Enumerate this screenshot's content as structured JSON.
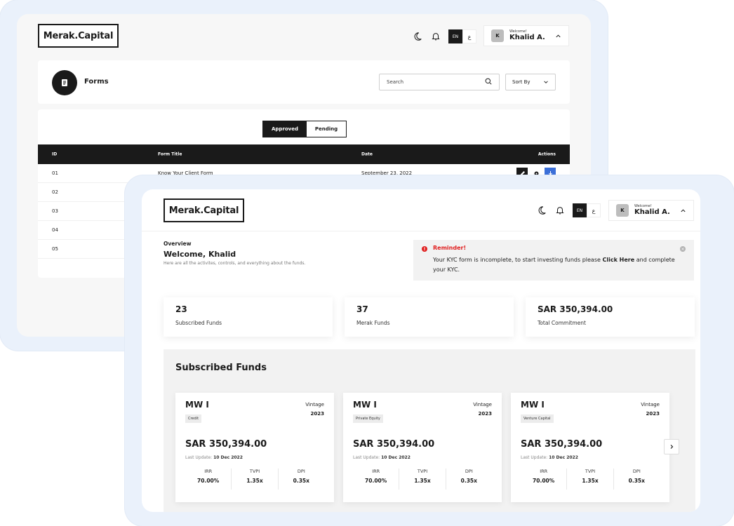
{
  "brand": "Merak.Capital",
  "topbar": {
    "lang_en": "EN",
    "lang_ar": "ع",
    "welcome": "Welcome!",
    "user_name": "Khalid A.",
    "avatar_letter": "K",
    "icons": [
      "moon-icon",
      "bell-icon",
      "chevron-up-icon"
    ]
  },
  "forms_window": {
    "title": "Forms",
    "search_placeholder": "Search",
    "sort_label": "Sort By",
    "tabs": [
      "Approved",
      "Pending"
    ],
    "active_tab": "Approved",
    "columns": [
      "ID",
      "Form Title",
      "Date",
      "Actions"
    ],
    "rows": [
      {
        "id": "01",
        "title": "Know Your Client Form",
        "date": "September 23, 2022"
      },
      {
        "id": "02",
        "title": "",
        "date": ""
      },
      {
        "id": "03",
        "title": "",
        "date": ""
      },
      {
        "id": "04",
        "title": "",
        "date": ""
      },
      {
        "id": "05",
        "title": "",
        "date": ""
      }
    ]
  },
  "dashboard": {
    "overview_label": "Overview",
    "welcome_title": "Welcome, Khalid",
    "subtitle": "Here are all the activites, controls, and everything about the funds.",
    "reminder": {
      "title": "Reminder!",
      "text": "Your KYC form is incomplete, to start investing funds please ",
      "link": "Click Here",
      "text_end": " and complete your KYC."
    },
    "stats": [
      {
        "value": "23",
        "label": "Subscribed Funds"
      },
      {
        "value": "37",
        "label": "Merak Funds"
      },
      {
        "value": "SAR 350,394.00",
        "label": "Total Commitment"
      }
    ],
    "funds_title": "Subscribed Funds",
    "funds": [
      {
        "name": "MW I",
        "vintage_label": "Vintage",
        "vintage": "2023",
        "tag": "Credit",
        "amount": "SAR 350,394.00",
        "update_label": "Last Update:",
        "update_date": "10 Dec 2022",
        "irr": "70.00%",
        "tvpi": "1.35x",
        "dpi": "0.35x"
      },
      {
        "name": "MW I",
        "vintage_label": "Vintage",
        "vintage": "2023",
        "tag": "Private Equity",
        "amount": "SAR 350,394.00",
        "update_label": "Last Update:",
        "update_date": "10 Dec 2022",
        "irr": "70.00%",
        "tvpi": "1.35x",
        "dpi": "0.35x"
      },
      {
        "name": "MW I",
        "vintage_label": "Vintage",
        "vintage": "2023",
        "tag": "Venture Capital",
        "amount": "SAR 350,394.00",
        "update_label": "Last Update:",
        "update_date": "10 Dec 2022",
        "irr": "70.00%",
        "tvpi": "1.35x",
        "dpi": "0.35x"
      }
    ],
    "metric_labels": [
      "IRR",
      "TVPI",
      "DPI"
    ]
  },
  "colors": {
    "accent": "#1a1a1a",
    "alert": "#e02020",
    "frame": "#eaf1fb",
    "edit_btn": "#1a1a1a",
    "download_btn": "#3b6fd8"
  }
}
